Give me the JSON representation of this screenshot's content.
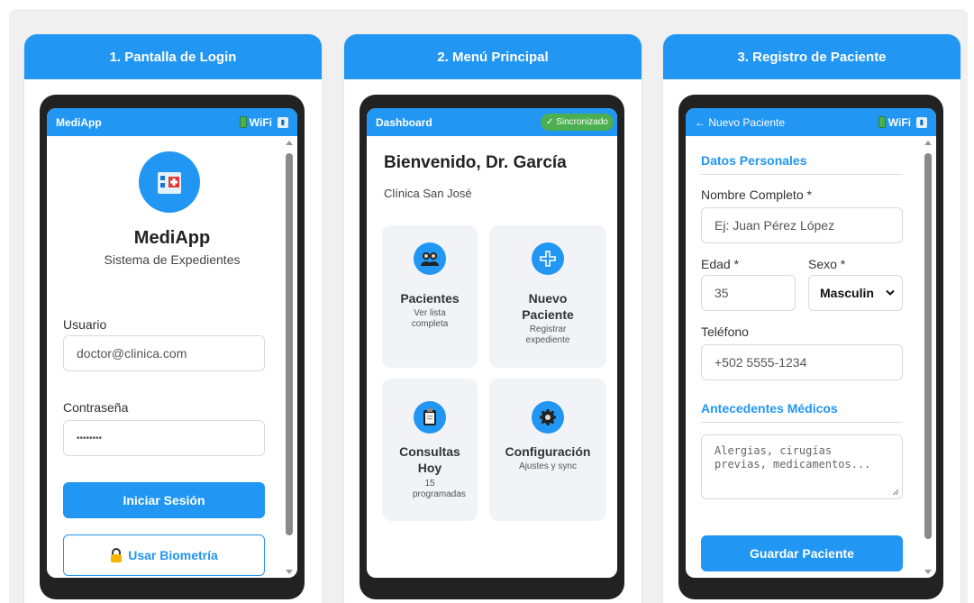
{
  "panels": [
    {
      "header": "1. Pantalla de Login",
      "status": {
        "title": "MediApp",
        "wifi": "WiFi",
        "signal": "📶"
      },
      "app_name": "MediApp",
      "subtitle": "Sistema de Expedientes",
      "user_label": "Usuario",
      "user_value": "doctor@clinica.com",
      "password_label": "Contraseña",
      "password_value": "••••••••",
      "login_button": "Iniciar Sesión",
      "biometric_button": "Usar Biometría",
      "logo_icon": "hospital-icon",
      "biometric_icon": "lock-icon"
    },
    {
      "header": "2. Menú Principal",
      "status": {
        "title": "Dashboard",
        "sync_badge": "✓ Sincronizado"
      },
      "welcome": "Bienvenido, Dr. García",
      "clinic": "Clínica San José",
      "tiles": [
        {
          "title": "Pacientes",
          "sub": "Ver lista completa",
          "icon": "patients-icon"
        },
        {
          "title": "Nuevo Paciente",
          "sub": "Registrar expediente",
          "icon": "plus-icon"
        },
        {
          "title": "Consultas Hoy",
          "sub": "15 programadas",
          "icon": "clipboard-icon"
        },
        {
          "title": "Configuración",
          "sub": "Ajustes y sync",
          "icon": "gear-icon"
        }
      ]
    },
    {
      "header": "3. Registro de Paciente",
      "status": {
        "title": "← Nuevo Paciente",
        "wifi": "WiFi",
        "signal": "📶"
      },
      "section_personal": "Datos Personales",
      "name_label": "Nombre Completo *",
      "name_placeholder": "Ej: Juan Pérez López",
      "age_label": "Edad *",
      "age_value": "35",
      "sex_label": "Sexo *",
      "sex_selected": "Masculin",
      "phone_label": "Teléfono",
      "phone_value": "+502 5555-1234",
      "section_medical": "Antecedentes Médicos",
      "history_placeholder": "Alergias, cirugías previas, medicamentos...",
      "save_button": "Guardar Paciente"
    }
  ],
  "colors": {
    "primary": "#2196f3",
    "success": "#4caf50",
    "tile_bg": "#f2f3f7",
    "phone_frame": "#222222"
  }
}
